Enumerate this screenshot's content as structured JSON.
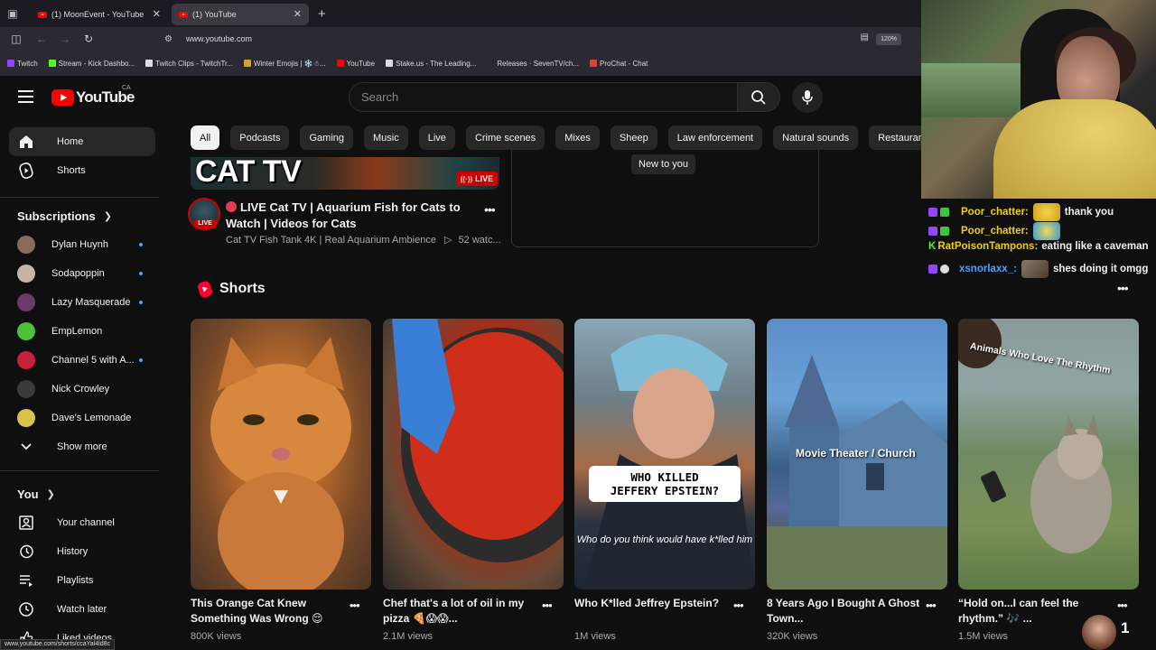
{
  "browser": {
    "tabs": [
      {
        "label": "(1) MoonEvent - YouTube"
      },
      {
        "label": "(1) YouTube"
      }
    ],
    "url": "www.youtube.com",
    "zoom": "120%",
    "bookmarks": [
      {
        "label": "Twitch",
        "color": "#9146ff"
      },
      {
        "label": "Stream - Kick Dashbo...",
        "color": "#53fc18"
      },
      {
        "label": "Twitch Clips - TwitchTr...",
        "color": "#dddddd"
      },
      {
        "label": "Winter Emojis | ❄️☃...",
        "color": "#d8a12a"
      },
      {
        "label": "YouTube",
        "color": "#ff0000"
      },
      {
        "label": "Stake.us - The Leading...",
        "color": "#dddddd"
      },
      {
        "label": "Releases · SevenTV/ch...",
        "color": "#2b2a33"
      },
      {
        "label": "ProChat - Chat",
        "color": "#e04040"
      }
    ],
    "status_url": "www.youtube.com/shorts/ccaYal4ld8c"
  },
  "masthead": {
    "logo_text": "YouTube",
    "country": "CA",
    "search_placeholder": "Search"
  },
  "sidebar": {
    "main": [
      {
        "label": "Home",
        "icon": "home-icon"
      },
      {
        "label": "Shorts",
        "icon": "shorts-icon"
      }
    ],
    "subscriptions_title": "Subscriptions",
    "subscriptions": [
      {
        "label": "Dylan Huynh",
        "new": true,
        "color": "#8a6a5a"
      },
      {
        "label": "Sodapoppin",
        "new": true,
        "color": "#c8b4a4"
      },
      {
        "label": "Lazy Masquerade",
        "new": true,
        "color": "#6a3a6a"
      },
      {
        "label": "EmpLemon",
        "new": false,
        "color": "#4fbf3a"
      },
      {
        "label": "Channel 5 with A...",
        "new": true,
        "color": "#c8203a"
      },
      {
        "label": "Nick Crowley",
        "new": false,
        "color": "#3a3a3a"
      },
      {
        "label": "Dave's Lemonade",
        "new": false,
        "color": "#d8c24a"
      }
    ],
    "show_more": "Show more",
    "you_title": "You",
    "you_items": [
      {
        "label": "Your channel",
        "icon": "your-channel-icon"
      },
      {
        "label": "History",
        "icon": "history-icon"
      },
      {
        "label": "Playlists",
        "icon": "playlists-icon"
      },
      {
        "label": "Watch later",
        "icon": "watch-later-icon"
      },
      {
        "label": "Liked videos",
        "icon": "liked-icon"
      }
    ]
  },
  "chips": [
    "All",
    "Podcasts",
    "Gaming",
    "Music",
    "Live",
    "Crime scenes",
    "Mixes",
    "Sheep",
    "Law enforcement",
    "Natural sounds",
    "Restaurants"
  ],
  "featured": {
    "thumb_text": "CAT TV",
    "live_badge": "LIVE",
    "avatar_badge": "LIVE",
    "title": "LIVE Cat TV | Aquarium Fish for Cats to Watch | Videos for Cats",
    "channel": "Cat TV Fish Tank 4K | Real Aquarium Ambience",
    "watching": "52 watc...",
    "ad_badge": "New to you"
  },
  "shorts": {
    "title": "Shorts",
    "items": [
      {
        "title": "This Orange Cat Knew Something Was Wrong 😌",
        "views": "800K views"
      },
      {
        "title": "Chef that's a lot of oil in my pizza 🍕😱😱...",
        "views": "2.1M views"
      },
      {
        "title": "Who K*lled Jeffrey Epstein?",
        "views": "1M views",
        "caption": "WHO KILLED\nJEFFERY EPSTEIN?",
        "subcaption": "Who do you think would have k*lled him"
      },
      {
        "title": "8 Years Ago I Bought A Ghost Town...",
        "views": "320K views",
        "caption": "Movie Theater / Church"
      },
      {
        "title": "“Hold on...I can feel the rhythm.” 🎶 ...",
        "views": "1.5M views",
        "caption": "Animals Who Love The Rhythm"
      }
    ]
  },
  "chat": [
    {
      "user": "Poor_chatter:",
      "message": "thank you",
      "color": "#f0d000"
    },
    {
      "user": "Poor_chatter:",
      "message": "",
      "color": "#f0d000"
    },
    {
      "user": "RatPoisonTampons:",
      "message": "eating like a caveman",
      "color": "#f0d000"
    },
    {
      "user": "xsnorlaxx_:",
      "message": "shes doing it omgg",
      "color": "#4aa3ff"
    }
  ],
  "viewer_count": "1"
}
